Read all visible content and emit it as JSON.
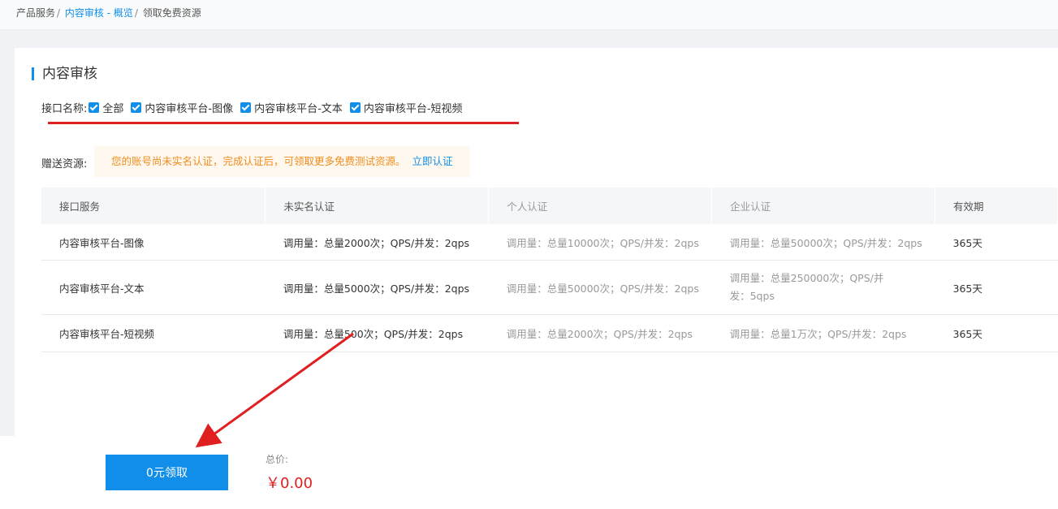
{
  "breadcrumb": {
    "item1": "产品服务",
    "item2": "内容审核 - 概览",
    "item3": "领取免费资源",
    "sep": "/"
  },
  "section": {
    "title": "内容审核"
  },
  "filters": {
    "label": "接口名称:",
    "options": [
      "全部",
      "内容审核平台-图像",
      "内容审核平台-文本",
      "内容审核平台-短视频"
    ]
  },
  "gift": {
    "label": "赠送资源:",
    "notice": "您的账号尚未实名认证，完成认证后，可领取更多免费测试资源。",
    "link": "立即认证"
  },
  "table": {
    "headers": [
      "接口服务",
      "未实名认证",
      "个人认证",
      "企业认证",
      "有效期"
    ],
    "rows": [
      [
        "内容审核平台-图像",
        "调用量：总量2000次；QPS/并发：2qps",
        "调用量：总量10000次；QPS/并发：2qps",
        "调用量：总量50000次；QPS/并发：2qps",
        "365天"
      ],
      [
        "内容审核平台-文本",
        "调用量：总量5000次；QPS/并发：2qps",
        "调用量：总量50000次；QPS/并发：2qps",
        "调用量：总量250000次；QPS/并发：5qps",
        "365天"
      ],
      [
        "内容审核平台-短视频",
        "调用量：总量500次；QPS/并发：2qps",
        "调用量：总量2000次；QPS/并发：2qps",
        "调用量：总量1万次；QPS/并发：2qps",
        "365天"
      ]
    ]
  },
  "footer": {
    "button": "0元领取",
    "total_label": "总价:",
    "price": "￥0.00"
  },
  "colors": {
    "accent": "#108ee9",
    "annotation": "#e02020",
    "warning": "#f08c1e"
  }
}
